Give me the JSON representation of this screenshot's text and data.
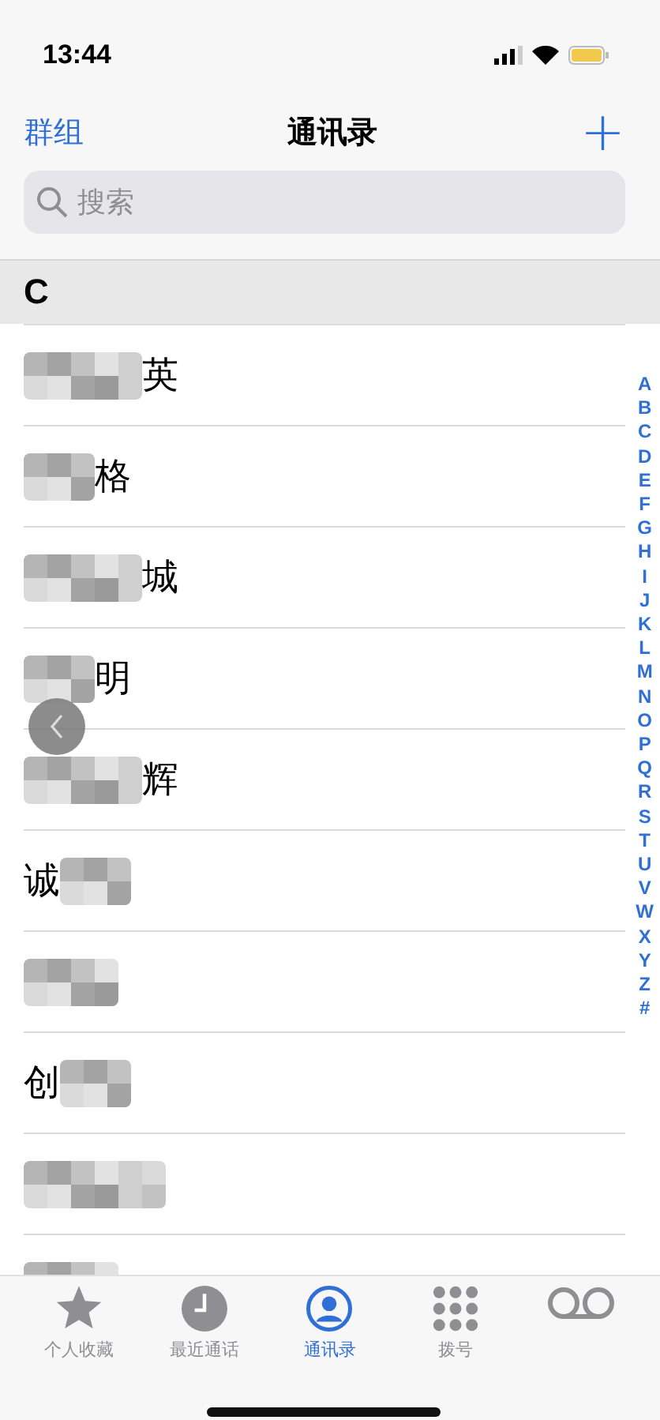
{
  "status_bar": {
    "time": "13:44"
  },
  "nav": {
    "left": "群组",
    "title": "通讯录",
    "add": "+"
  },
  "search": {
    "placeholder": "搜索"
  },
  "section": {
    "letter": "C"
  },
  "contacts": [
    {
      "text": "英",
      "kind": "mosaic_start"
    },
    {
      "text": "格",
      "kind": "mosaic_start"
    },
    {
      "text": "城",
      "kind": "mosaic_start"
    },
    {
      "text": "明",
      "kind": "mosaic_start"
    },
    {
      "text": "辉",
      "kind": "mosaic_start"
    },
    {
      "text": "诚",
      "kind": "mosaic_end"
    },
    {
      "kind": "mosaic_whole"
    },
    {
      "text": "创",
      "kind": "mosaic_end"
    },
    {
      "kind": "mosaic_whole"
    },
    {
      "kind": "mosaic_whole"
    }
  ],
  "index": [
    "A",
    "B",
    "C",
    "D",
    "E",
    "F",
    "G",
    "H",
    "I",
    "J",
    "K",
    "L",
    "M",
    "N",
    "O",
    "P",
    "Q",
    "R",
    "S",
    "T",
    "U",
    "V",
    "W",
    "X",
    "Y",
    "Z",
    "#"
  ],
  "tabs": [
    {
      "kind": "star",
      "label": "个人收藏",
      "selected": false
    },
    {
      "kind": "clock",
      "label": "最近通话",
      "selected": false
    },
    {
      "kind": "person",
      "label": "通讯录",
      "selected": true
    },
    {
      "kind": "keypad",
      "label": "拨号",
      "selected": false
    },
    {
      "kind": "voicemail",
      "selected": false
    }
  ]
}
